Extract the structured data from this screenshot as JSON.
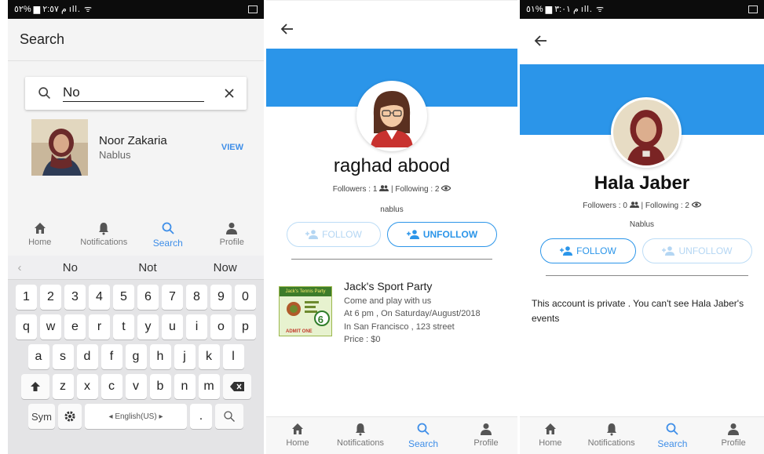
{
  "screen1": {
    "status_text": "م ٢:٥٧ ▆ %٥٢ ıll. ᯤ",
    "title": "Search",
    "search_value": "No",
    "result": {
      "name": "Noor Zakaria",
      "city": "Nablus",
      "action": "VIEW"
    },
    "nav": [
      "Home",
      "Notifications",
      "Search",
      "Profile"
    ],
    "suggestions": [
      "No",
      "Not",
      "Now"
    ],
    "keys_row1": [
      "1",
      "2",
      "3",
      "4",
      "5",
      "6",
      "7",
      "8",
      "9",
      "0"
    ],
    "keys_row2": [
      "q",
      "w",
      "e",
      "r",
      "t",
      "y",
      "u",
      "i",
      "o",
      "p"
    ],
    "keys_row3": [
      "a",
      "s",
      "d",
      "f",
      "g",
      "h",
      "j",
      "k",
      "l"
    ],
    "keys_row4": [
      "z",
      "x",
      "c",
      "v",
      "b",
      "n",
      "m"
    ],
    "sym_label": "Sym",
    "space_label": "◂ English(US) ▸",
    "period_label": "."
  },
  "screen2": {
    "name": "raghad abood",
    "followers": "Followers : 1",
    "following": "| Following : 2",
    "city": "nablus",
    "follow_label": "FOLLOW",
    "unfollow_label": "UNFOLLOW",
    "event": {
      "title": "Jack's Sport Party",
      "lines": [
        "Come and play with us",
        "At 6 pm , On Saturday/August/2018",
        "In San Francisco , 123 street",
        "Price : $0"
      ],
      "ticket_text": "Jack's Tennis Party",
      "ticket_number": "6",
      "ticket_admit": "ADMIT ONE"
    },
    "nav": [
      "Home",
      "Notifications",
      "Search",
      "Profile"
    ]
  },
  "screen3": {
    "status_text": "م ٣:٠١ ▆ %٥١ ıll. ᯤ",
    "name": "Hala Jaber",
    "followers": "Followers : 0",
    "following": "| Following : 2",
    "city": "Nablus",
    "follow_label": "FOLLOW",
    "unfollow_label": "UNFOLLOW",
    "private_message": "This account is private . You can't see Hala Jaber's events",
    "nav": [
      "Home",
      "Notifications",
      "Search",
      "Profile"
    ]
  },
  "colors": {
    "accent": "#2b95e9",
    "link": "#3e8ee8"
  }
}
